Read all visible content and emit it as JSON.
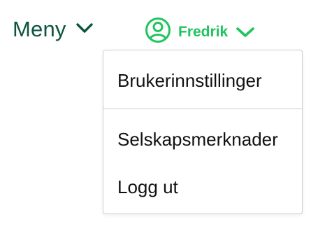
{
  "header": {
    "menu_label": "Meny",
    "user_name": "Fredrik"
  },
  "icons": {
    "menu_chevron": "chevron-down-icon",
    "user_avatar": "user-circle-icon",
    "user_chevron": "chevron-down-icon"
  },
  "dropdown": {
    "items": [
      {
        "label": "Brukerinnstillinger"
      },
      {
        "label": "Selskapsmerknader"
      },
      {
        "label": "Logg ut"
      }
    ]
  },
  "colors": {
    "menu_text": "#0e5440",
    "accent_green": "#1fc55e",
    "dropdown_border": "#c9ced1",
    "item_text": "#111111"
  }
}
